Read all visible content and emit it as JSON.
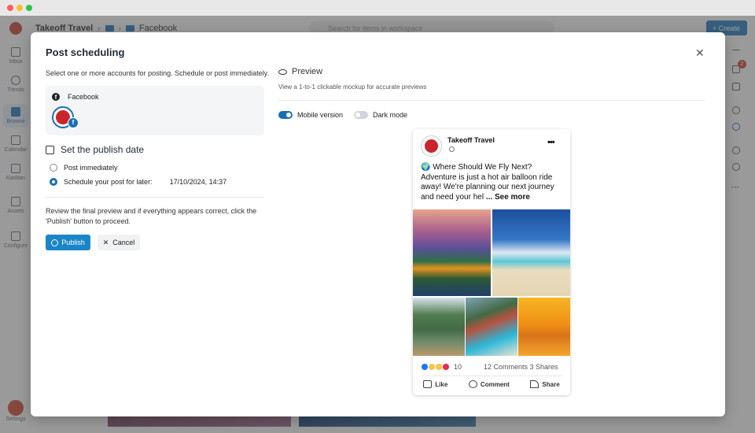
{
  "window": {
    "traffic_lights": {
      "close": "#ff5f57",
      "minimize": "#febc2e",
      "maximize": "#28c840"
    }
  },
  "sidebar": {
    "items": [
      {
        "label": "Inbox",
        "icon": "inbox-icon"
      },
      {
        "label": "Trends",
        "icon": "trends-icon"
      },
      {
        "label": "Browse",
        "icon": "browse-icon",
        "active": true
      },
      {
        "label": "Calendar",
        "icon": "calendar-icon"
      },
      {
        "label": "Kanban",
        "icon": "kanban-icon"
      },
      {
        "label": "Assets",
        "icon": "assets-icon"
      },
      {
        "label": "Configure",
        "icon": "configure-icon"
      }
    ],
    "settings_label": "Settings"
  },
  "topbar": {
    "breadcrumb": [
      "Takeoff Travel",
      "Facebook"
    ],
    "search_placeholder": "Search for items in workspace",
    "create_label": "Create"
  },
  "rightbar": {
    "comments_badge": "2"
  },
  "modal": {
    "title": "Post scheduling",
    "subtitle": "Select one or more accounts for posting. Schedule or post immediately.",
    "account_platform": "Facebook",
    "publish_section_title": "Set the publish date",
    "options": [
      {
        "label": "Post immediately",
        "selected": false
      },
      {
        "label": "Schedule your post for later:",
        "selected": true,
        "value": "17/10/2024, 14:37"
      }
    ],
    "review_text": "Review the final preview and if everything appears correct, click the 'Publish' button to proceed.",
    "publish_label": "Publish",
    "cancel_label": "Cancel"
  },
  "preview": {
    "title": "Preview",
    "subtitle": "View a 1-to-1 clickable mockup for accurate previews",
    "mobile_version_label": "Mobile version",
    "mobile_version_on": true,
    "dark_mode_label": "Dark mode",
    "dark_mode_on": false,
    "post": {
      "page_name": "Takeoff Travel",
      "text": "🌍 Where Should We Fly Next? Adventure is just a hot air balloon ride away! We're planning our next journey and need your hel",
      "see_more": "... See more",
      "reaction_count": "10",
      "stats": "12 Comments 3 Shares",
      "actions": [
        "Like",
        "Comment",
        "Share"
      ]
    }
  },
  "colors": {
    "accent": "#1a6fb3",
    "publish_button": "#1a86c8",
    "brand_red": "#c9252c",
    "badge": "#c4421f"
  }
}
